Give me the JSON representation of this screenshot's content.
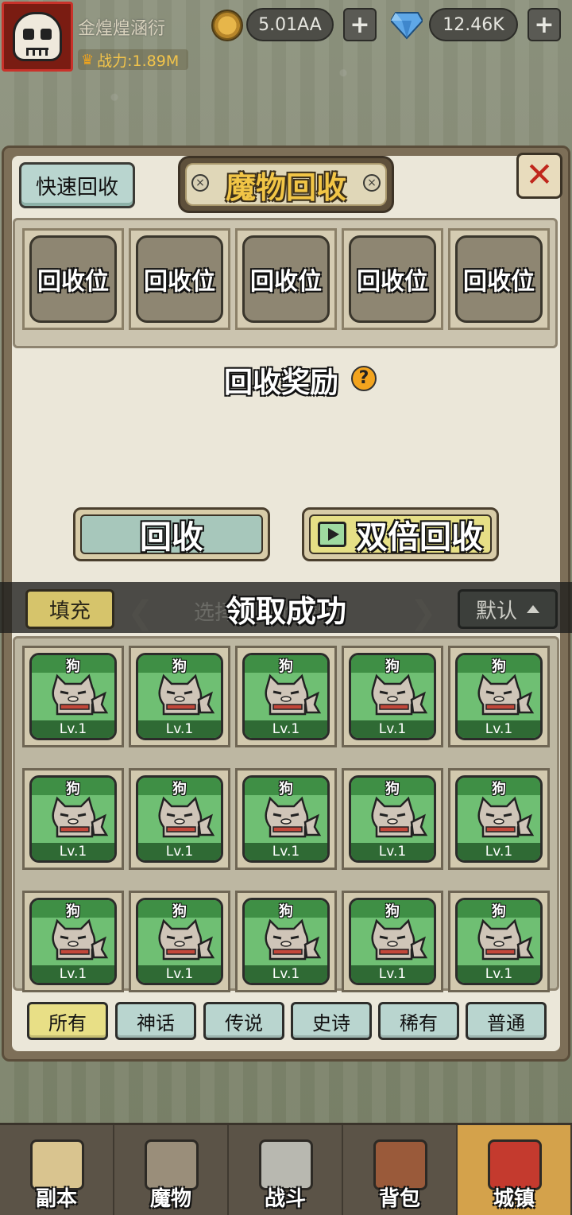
{
  "hud": {
    "player_name": "金煌煌涵衍",
    "power_label": "战力:1.89M",
    "gold": "5.01AA",
    "gems": "12.46K",
    "plus": "+"
  },
  "panel": {
    "quick_recycle": "快速回收",
    "title": "魔物回收",
    "close": "✕",
    "slots": [
      "回收位",
      "回收位",
      "回收位",
      "回收位",
      "回收位"
    ],
    "reward_title": "回收奖励",
    "help": "?",
    "recycle_button": "回收",
    "double_recycle_button": "双倍回收"
  },
  "filter": {
    "fill_button": "填充",
    "hint": "选择回收的魔物",
    "toast": "领取成功",
    "sort_button": "默认"
  },
  "monsters": [
    {
      "name": "狗",
      "level": "Lv.1"
    },
    {
      "name": "狗",
      "level": "Lv.1"
    },
    {
      "name": "狗",
      "level": "Lv.1"
    },
    {
      "name": "狗",
      "level": "Lv.1"
    },
    {
      "name": "狗",
      "level": "Lv.1"
    },
    {
      "name": "狗",
      "level": "Lv.1"
    },
    {
      "name": "狗",
      "level": "Lv.1"
    },
    {
      "name": "狗",
      "level": "Lv.1"
    },
    {
      "name": "狗",
      "level": "Lv.1"
    },
    {
      "name": "狗",
      "level": "Lv.1"
    },
    {
      "name": "狗",
      "level": "Lv.1"
    },
    {
      "name": "狗",
      "level": "Lv.1"
    },
    {
      "name": "狗",
      "level": "Lv.1"
    },
    {
      "name": "狗",
      "level": "Lv.1"
    },
    {
      "name": "狗",
      "level": "Lv.1"
    }
  ],
  "rarity_tabs": [
    {
      "label": "所有",
      "active": true
    },
    {
      "label": "神话",
      "active": false
    },
    {
      "label": "传说",
      "active": false
    },
    {
      "label": "史诗",
      "active": false
    },
    {
      "label": "稀有",
      "active": false
    },
    {
      "label": "普通",
      "active": false
    }
  ],
  "bottom_nav": [
    {
      "label": "副本",
      "icon": "map-icon",
      "active": false
    },
    {
      "label": "魔物",
      "icon": "monster-icon",
      "active": false
    },
    {
      "label": "战斗",
      "icon": "crossed-swords-icon",
      "active": false
    },
    {
      "label": "背包",
      "icon": "backpack-icon",
      "active": false
    },
    {
      "label": "城镇",
      "icon": "shop-icon",
      "active": true
    }
  ],
  "colors": {
    "card_green": "#6fbf73",
    "tab_active": "#e8df86",
    "tab_inactive": "#b9d5cf",
    "title_gold": "#f1c546",
    "close_red": "#c0271c",
    "nav_active": "#d4a24b"
  }
}
